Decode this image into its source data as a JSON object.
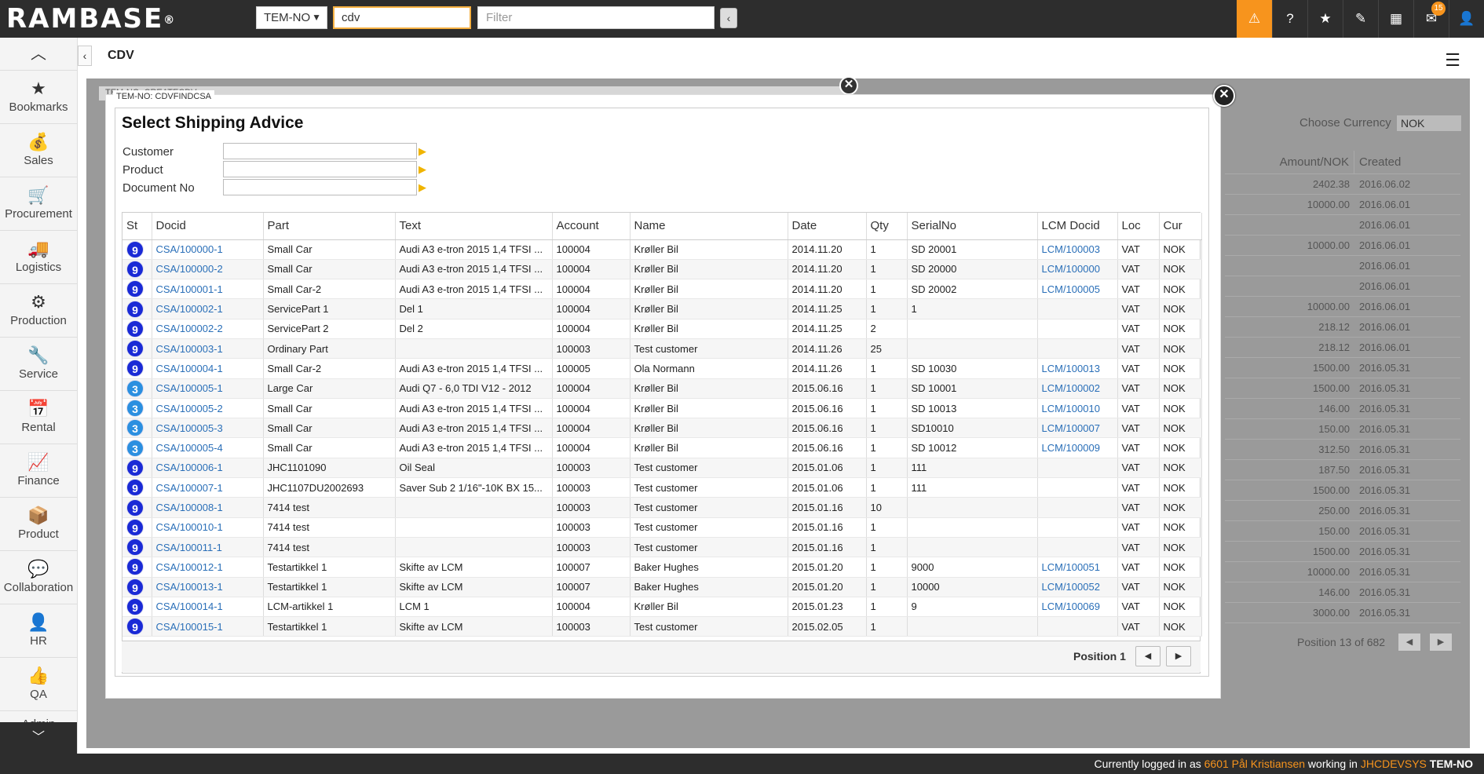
{
  "app": {
    "logo": "RAMBASE",
    "logo_mark": "®"
  },
  "topbar": {
    "company": "TEM-NO",
    "program_input": "cdv",
    "filter_placeholder": "Filter",
    "collapse_glyph": "‹",
    "icons": [
      "warning-icon",
      "help-icon",
      "bookmark-icon",
      "attachment-icon",
      "calendar-icon",
      "mail-icon",
      "user-icon"
    ],
    "icon_glyphs": [
      "⚠",
      "?",
      "★",
      "✎",
      "▦",
      "✉",
      "👤"
    ],
    "mail_count": "15"
  },
  "sidebar": {
    "up_glyph": "︿",
    "down_glyph": "﹀",
    "items": [
      {
        "label": "Bookmarks",
        "icon": "★"
      },
      {
        "label": "Sales",
        "icon": "💰"
      },
      {
        "label": "Procurement",
        "icon": "🛒"
      },
      {
        "label": "Logistics",
        "icon": "🚚"
      },
      {
        "label": "Production",
        "icon": "⚙"
      },
      {
        "label": "Service",
        "icon": "🔧"
      },
      {
        "label": "Rental",
        "icon": "📅"
      },
      {
        "label": "Finance",
        "icon": "📈"
      },
      {
        "label": "Product",
        "icon": "📦"
      },
      {
        "label": "Collaboration",
        "icon": "💬"
      },
      {
        "label": "HR",
        "icon": "👤"
      },
      {
        "label": "QA",
        "icon": "👍"
      },
      {
        "label": "Admin",
        "icon": "⚙"
      }
    ]
  },
  "page": {
    "title": "CDV",
    "back_glyph": "‹",
    "menu_glyph": "☰"
  },
  "background": {
    "dialog_tag": "TEM-NO: CREATECDV",
    "currency_label": "Choose Currency",
    "currency_value": "NOK",
    "headers": [
      "Amount/NOK",
      "Created"
    ],
    "rows": [
      [
        "2402.38",
        "2016.06.02"
      ],
      [
        "10000.00",
        "2016.06.01"
      ],
      [
        "",
        "2016.06.01"
      ],
      [
        "10000.00",
        "2016.06.01"
      ],
      [
        "",
        "2016.06.01"
      ],
      [
        "",
        "2016.06.01"
      ],
      [
        "10000.00",
        "2016.06.01"
      ],
      [
        "218.12",
        "2016.06.01"
      ],
      [
        "218.12",
        "2016.06.01"
      ],
      [
        "1500.00",
        "2016.05.31"
      ],
      [
        "1500.00",
        "2016.05.31"
      ],
      [
        "146.00",
        "2016.05.31"
      ],
      [
        "150.00",
        "2016.05.31"
      ],
      [
        "312.50",
        "2016.05.31"
      ],
      [
        "187.50",
        "2016.05.31"
      ],
      [
        "1500.00",
        "2016.05.31"
      ],
      [
        "250.00",
        "2016.05.31"
      ],
      [
        "150.00",
        "2016.05.31"
      ],
      [
        "1500.00",
        "2016.05.31"
      ],
      [
        "10000.00",
        "2016.05.31"
      ],
      [
        "146.00",
        "2016.05.31"
      ],
      [
        "3000.00",
        "2016.05.31"
      ]
    ],
    "position": "Position 13 of 682"
  },
  "modal": {
    "tag": "TEM-NO: CDVFINDCSA",
    "title": "Select Shipping Advice",
    "close_glyph": "✕",
    "fields": [
      {
        "label": "Customer",
        "value": ""
      },
      {
        "label": "Product",
        "value": ""
      },
      {
        "label": "Document No",
        "value": ""
      }
    ],
    "columns": [
      "St",
      "Docid",
      "Part",
      "Text",
      "Account",
      "Name",
      "Date",
      "Qty",
      "SerialNo",
      "LCM Docid",
      "Loc",
      "Cur"
    ],
    "rows": [
      [
        "9",
        "CSA/100000-1",
        "Small Car",
        "Audi A3 e-tron 2015 1,4 TFSI ...",
        "100004",
        "Krøller Bil",
        "2014.11.20",
        "1",
        "SD 20001",
        "LCM/100003",
        "VAT",
        "NOK"
      ],
      [
        "9",
        "CSA/100000-2",
        "Small Car",
        "Audi A3 e-tron 2015 1,4 TFSI ...",
        "100004",
        "Krøller Bil",
        "2014.11.20",
        "1",
        "SD 20000",
        "LCM/100000",
        "VAT",
        "NOK"
      ],
      [
        "9",
        "CSA/100001-1",
        "Small Car-2",
        "Audi A3 e-tron 2015 1,4 TFSI ...",
        "100004",
        "Krøller Bil",
        "2014.11.20",
        "1",
        "SD 20002",
        "LCM/100005",
        "VAT",
        "NOK"
      ],
      [
        "9",
        "CSA/100002-1",
        "ServicePart 1",
        "Del 1",
        "100004",
        "Krøller Bil",
        "2014.11.25",
        "1",
        "1",
        "",
        "VAT",
        "NOK"
      ],
      [
        "9",
        "CSA/100002-2",
        "ServicePart 2",
        "Del 2",
        "100004",
        "Krøller Bil",
        "2014.11.25",
        "2",
        "",
        "",
        "VAT",
        "NOK"
      ],
      [
        "9",
        "CSA/100003-1",
        "Ordinary Part",
        "",
        "100003",
        "Test customer",
        "2014.11.26",
        "25",
        "",
        "",
        "VAT",
        "NOK"
      ],
      [
        "9",
        "CSA/100004-1",
        "Small Car-2",
        "Audi A3 e-tron 2015 1,4 TFSI ...",
        "100005",
        "Ola Normann",
        "2014.11.26",
        "1",
        "SD 10030",
        "LCM/100013",
        "VAT",
        "NOK"
      ],
      [
        "3",
        "CSA/100005-1",
        "Large Car",
        "Audi Q7 - 6,0 TDI V12 - 2012",
        "100004",
        "Krøller Bil",
        "2015.06.16",
        "1",
        "SD 10001",
        "LCM/100002",
        "VAT",
        "NOK"
      ],
      [
        "3",
        "CSA/100005-2",
        "Small Car",
        "Audi A3 e-tron 2015 1,4 TFSI ...",
        "100004",
        "Krøller Bil",
        "2015.06.16",
        "1",
        "SD 10013",
        "LCM/100010",
        "VAT",
        "NOK"
      ],
      [
        "3",
        "CSA/100005-3",
        "Small Car",
        "Audi A3 e-tron 2015 1,4 TFSI ...",
        "100004",
        "Krøller Bil",
        "2015.06.16",
        "1",
        "SD10010",
        "LCM/100007",
        "VAT",
        "NOK"
      ],
      [
        "3",
        "CSA/100005-4",
        "Small Car",
        "Audi A3 e-tron 2015 1,4 TFSI ...",
        "100004",
        "Krøller Bil",
        "2015.06.16",
        "1",
        "SD 10012",
        "LCM/100009",
        "VAT",
        "NOK"
      ],
      [
        "9",
        "CSA/100006-1",
        "JHC1101090",
        "Oil Seal",
        "100003",
        "Test customer",
        "2015.01.06",
        "1",
        "111",
        "",
        "VAT",
        "NOK"
      ],
      [
        "9",
        "CSA/100007-1",
        "JHC1107DU2002693",
        "Saver Sub 2 1/16\"-10K BX 15...",
        "100003",
        "Test customer",
        "2015.01.06",
        "1",
        "111",
        "",
        "VAT",
        "NOK"
      ],
      [
        "9",
        "CSA/100008-1",
        "7414 test",
        "",
        "100003",
        "Test customer",
        "2015.01.16",
        "10",
        "",
        "",
        "VAT",
        "NOK"
      ],
      [
        "9",
        "CSA/100010-1",
        "7414 test",
        "",
        "100003",
        "Test customer",
        "2015.01.16",
        "1",
        "",
        "",
        "VAT",
        "NOK"
      ],
      [
        "9",
        "CSA/100011-1",
        "7414 test",
        "",
        "100003",
        "Test customer",
        "2015.01.16",
        "1",
        "",
        "",
        "VAT",
        "NOK"
      ],
      [
        "9",
        "CSA/100012-1",
        "Testartikkel 1",
        "Skifte av LCM",
        "100007",
        "Baker Hughes",
        "2015.01.20",
        "1",
        "9000",
        "LCM/100051",
        "VAT",
        "NOK"
      ],
      [
        "9",
        "CSA/100013-1",
        "Testartikkel 1",
        "Skifte av LCM",
        "100007",
        "Baker Hughes",
        "2015.01.20",
        "1",
        "10000",
        "LCM/100052",
        "VAT",
        "NOK"
      ],
      [
        "9",
        "CSA/100014-1",
        "LCM-artikkel 1",
        "LCM 1",
        "100004",
        "Krøller Bil",
        "2015.01.23",
        "1",
        "9",
        "LCM/100069",
        "VAT",
        "NOK"
      ],
      [
        "9",
        "CSA/100015-1",
        "Testartikkel 1",
        "Skifte av LCM",
        "100003",
        "Test customer",
        "2015.02.05",
        "1",
        "",
        "",
        "VAT",
        "NOK"
      ]
    ],
    "position": "Position 1",
    "prev_glyph": "◀",
    "next_glyph": "▶"
  },
  "status": {
    "prefix": "Currently logged in as ",
    "user": "6601 Pål Kristiansen",
    "mid": " working in ",
    "system": "JHCDEVSYS",
    "company": "TEM-NO",
    "colors": {
      "highlight": "#f7941d",
      "bar": "#2d2d2d"
    }
  }
}
